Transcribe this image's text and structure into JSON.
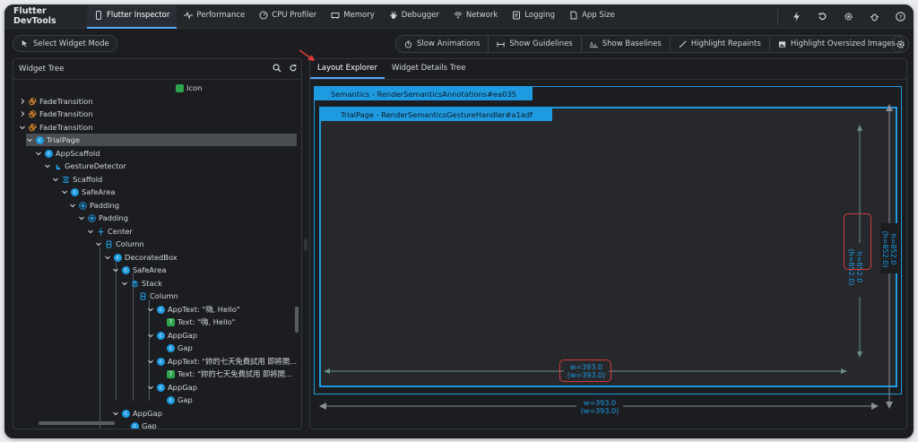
{
  "app": {
    "title": "Flutter DevTools"
  },
  "tabs": [
    {
      "label": "Flutter Inspector",
      "icon": "phone-icon"
    },
    {
      "label": "Performance",
      "icon": "pulse-icon"
    },
    {
      "label": "CPU Profiler",
      "icon": "gauge-icon"
    },
    {
      "label": "Memory",
      "icon": "memory-icon"
    },
    {
      "label": "Debugger",
      "icon": "bug-icon"
    },
    {
      "label": "Network",
      "icon": "wifi-icon"
    },
    {
      "label": "Logging",
      "icon": "logging-icon"
    },
    {
      "label": "App Size",
      "icon": "file-icon"
    }
  ],
  "toolbar": {
    "select_widget_mode": "Select Widget Mode",
    "slow_animations": "Slow Animations",
    "show_guidelines": "Show Guidelines",
    "show_baselines": "Show Baselines",
    "highlight_repaints": "Highlight Repaints",
    "highlight_oversized_images": "Highlight Oversized Images"
  },
  "widget_tree": {
    "title": "Widget Tree",
    "rows": [
      "Icon",
      "FadeTransition",
      "FadeTransition",
      "FadeTransition",
      "TrialPage",
      "AppScaffold",
      "GestureDetector",
      "Scaffold",
      "SafeArea",
      "Padding",
      "Padding",
      "Center",
      "Column",
      "DecoratedBox",
      "SafeArea",
      "Stack",
      "Column",
      "AppText: \"嗨, Hello\"",
      "Text: \"嗨, Hello\"",
      "AppGap",
      "Gap",
      "AppText: \"妳的七天免費試用 即將開...",
      "Text: \"妳的七天免費試用 即將開...",
      "AppGap",
      "Gap",
      "AppGap",
      "Gap"
    ]
  },
  "layout_explorer": {
    "tabs": [
      "Layout Explorer",
      "Widget Details Tree"
    ],
    "outer_label": "Semantics - RenderSemanticsAnnotations#ea035",
    "inner_label": "TrialPage - RenderSemanticsGestureHandler#a1adf",
    "inner_h": "h=852.0\n(h=852.0)",
    "inner_w": "w=393.0\n(w=393.0)",
    "outer_h": "h=852.0\n(h=852.0)",
    "outer_w": "w=393.0\n(w=393.0)",
    "inner_h_line1": "h=852.0",
    "inner_h_line2": "(h=852.0)",
    "inner_w_line1": "w=393.0",
    "inner_w_line2": "(w=393.0)",
    "outer_h_line1": "h=852.0",
    "outer_h_line2": "(h=852.0)",
    "outer_w_line1": "w=393.0",
    "outer_w_line2": "(w=393.0)"
  },
  "colors": {
    "accent": "#1e9be0",
    "highlight": "#d43a3a",
    "background": "#1b1d21"
  }
}
